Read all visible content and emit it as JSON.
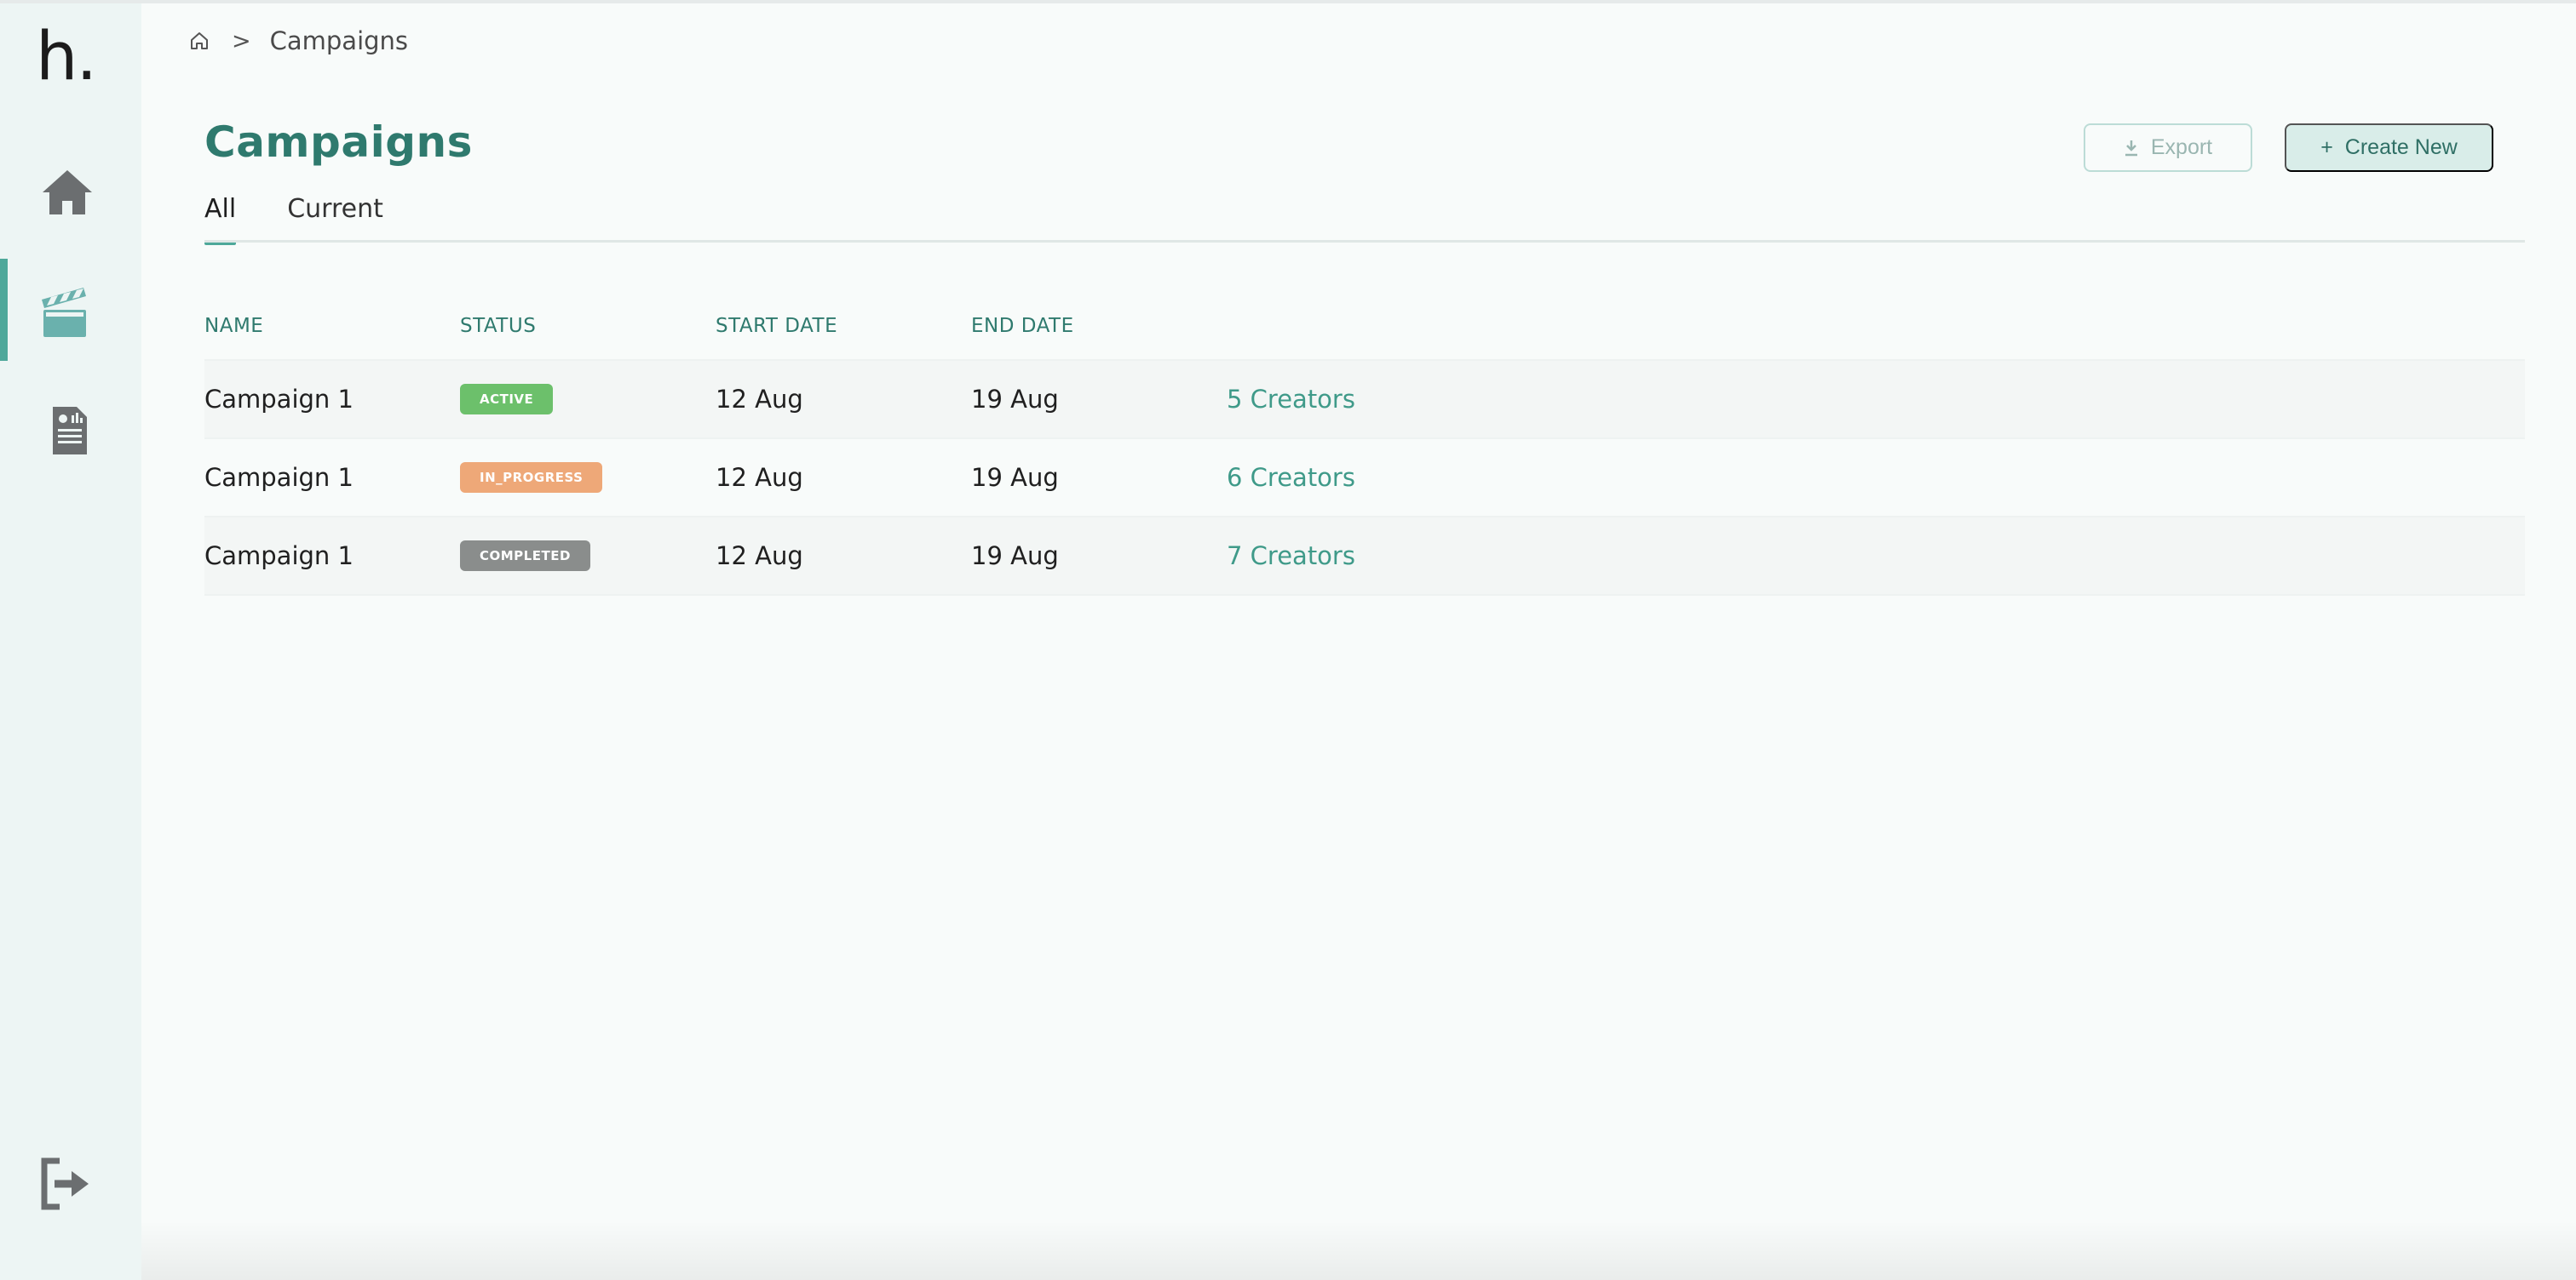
{
  "app": {
    "logo": "h."
  },
  "breadcrumb": {
    "current": "Campaigns",
    "separator": ">"
  },
  "page": {
    "title": "Campaigns"
  },
  "actions": {
    "export_label": "Export",
    "create_label": "Create New"
  },
  "tabs": [
    {
      "label": "All",
      "active": true
    },
    {
      "label": "Current",
      "active": false
    }
  ],
  "table": {
    "headers": [
      "NAME",
      "STATUS",
      "START DATE",
      "END DATE"
    ],
    "rows": [
      {
        "name": "Campaign 1",
        "status": "ACTIVE",
        "start": "12 Aug",
        "end": "19 Aug",
        "creators": "5 Creators"
      },
      {
        "name": "Campaign 1",
        "status": "IN_PROGRESS",
        "start": "12 Aug",
        "end": "19 Aug",
        "creators": "6 Creators"
      },
      {
        "name": "Campaign 1",
        "status": "COMPLETED",
        "start": "12 Aug",
        "end": "19 Aug",
        "creators": "7 Creators"
      }
    ]
  },
  "status_colors": {
    "ACTIVE": "#6cc06b",
    "IN_PROGRESS": "#eea878",
    "COMPLETED": "#8a8d8c"
  },
  "sidebar": {
    "items": [
      {
        "icon": "home-icon"
      },
      {
        "icon": "clapperboard-icon",
        "active": true
      },
      {
        "icon": "report-icon"
      }
    ],
    "footer_icon": "logout-icon"
  }
}
